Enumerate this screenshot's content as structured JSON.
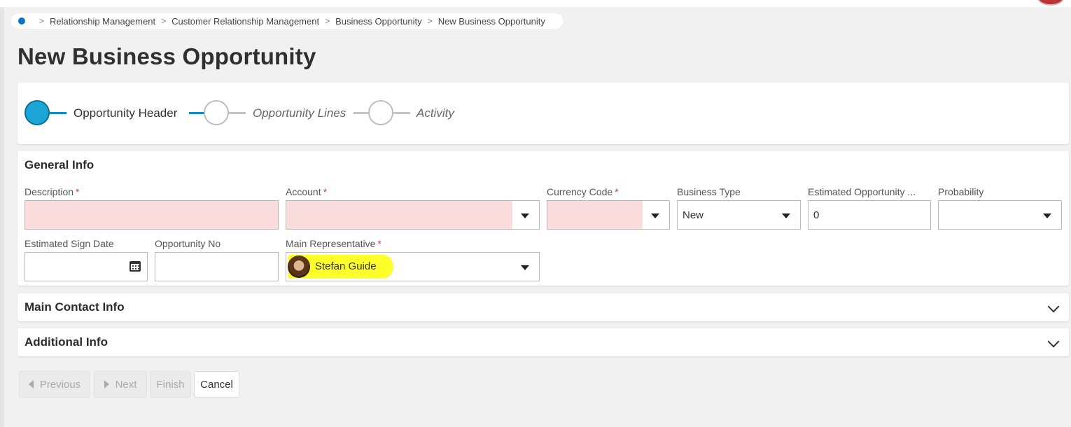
{
  "breadcrumb": {
    "items": [
      "Relationship Management",
      "Customer Relationship Management",
      "Business Opportunity",
      "New Business Opportunity"
    ]
  },
  "page": {
    "title": "New Business Opportunity"
  },
  "wizard": {
    "steps": [
      {
        "label": "Opportunity Header",
        "state": "active"
      },
      {
        "label": "Opportunity Lines",
        "state": "pending"
      },
      {
        "label": "Activity",
        "state": "pending"
      }
    ]
  },
  "general_info": {
    "title": "General Info",
    "fields": {
      "description": {
        "label": "Description",
        "required": true,
        "value": ""
      },
      "account": {
        "label": "Account",
        "required": true,
        "value": ""
      },
      "currency_code": {
        "label": "Currency Code",
        "required": true,
        "value": ""
      },
      "business_type": {
        "label": "Business Type",
        "value": "New"
      },
      "estimated_opportunity": {
        "label": "Estimated Opportunity ...",
        "value": "0"
      },
      "probability": {
        "label": "Probability",
        "value": ""
      },
      "estimated_sign_date": {
        "label": "Estimated Sign Date",
        "value": ""
      },
      "opportunity_no": {
        "label": "Opportunity No",
        "value": ""
      },
      "main_representative": {
        "label": "Main Representative",
        "required": true,
        "value": "Stefan Guide"
      }
    },
    "required_marker": "*"
  },
  "sections": {
    "main_contact": {
      "title": "Main Contact Info"
    },
    "additional": {
      "title": "Additional Info"
    }
  },
  "buttons": {
    "previous": "Previous",
    "next": "Next",
    "finish": "Finish",
    "cancel": "Cancel"
  },
  "colors": {
    "accent": "#1ba5d6",
    "required_bg": "#fbdcdc",
    "highlight": "#ffff29",
    "required_marker": "#d9343b"
  }
}
